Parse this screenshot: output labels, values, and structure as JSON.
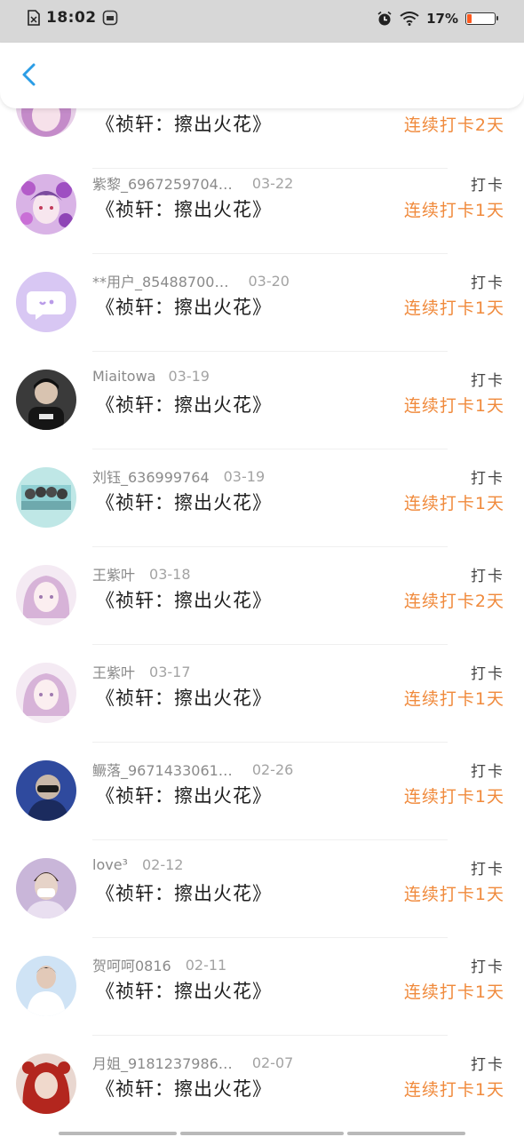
{
  "status_bar": {
    "time": "18:02",
    "battery_percent_text": "17%",
    "battery_level": 0.17,
    "left_icons": [
      "sim-off-icon",
      "app-notification-icon"
    ],
    "right_icons": [
      "alarm-icon",
      "wifi-icon",
      "battery-icon"
    ]
  },
  "app_bar": {
    "back_icon": "chevron-left-icon"
  },
  "colors": {
    "streak": "#f08a3c",
    "back_arrow": "#2b9de6",
    "username": "#8a8a8a"
  },
  "entries": [
    {
      "username": "",
      "date": "",
      "book": "《祯轩：擦出火花》",
      "tag": "",
      "streak": "连续打卡2天",
      "avatar": "anime-purple-hair"
    },
    {
      "username": "紫黎_6967259704…",
      "date": "03-22",
      "book": "《祯轩：擦出火花》",
      "tag": "打卡",
      "streak": "连续打卡1天",
      "avatar": "anime-purple-flowers"
    },
    {
      "username": "**用户_85488700…",
      "date": "03-20",
      "book": "《祯轩：擦出火花》",
      "tag": "打卡",
      "streak": "连续打卡1天",
      "avatar": "default-chat-bubble"
    },
    {
      "username": "Miaitowa",
      "date": "03-19",
      "book": "《祯轩：擦出火花》",
      "tag": "打卡",
      "streak": "连续打卡1天",
      "avatar": "dark-portrait"
    },
    {
      "username": "刘钰_636999764",
      "date": "03-19",
      "book": "《祯轩：擦出火花》",
      "tag": "打卡",
      "streak": "连续打卡1天",
      "avatar": "group-photo-teal"
    },
    {
      "username": "王紫叶",
      "date": "03-18",
      "book": "《祯轩：擦出火花》",
      "tag": "打卡",
      "streak": "连续打卡2天",
      "avatar": "anime-pink-hair"
    },
    {
      "username": "王紫叶",
      "date": "03-17",
      "book": "《祯轩：擦出火花》",
      "tag": "打卡",
      "streak": "连续打卡1天",
      "avatar": "anime-pink-hair"
    },
    {
      "username": "鳜落_9671433061…",
      "date": "02-26",
      "book": "《祯轩：擦出火花》",
      "tag": "打卡",
      "streak": "连续打卡1天",
      "avatar": "blue-portrait"
    },
    {
      "username": "love³",
      "date": "02-12",
      "book": "《祯轩：擦出火花》",
      "tag": "打卡",
      "streak": "连续打卡1天",
      "avatar": "masked-portrait"
    },
    {
      "username": "贺呵呵0816",
      "date": "02-11",
      "book": "《祯轩：擦出火花》",
      "tag": "打卡",
      "streak": "连续打卡1天",
      "avatar": "white-shirt-portrait"
    },
    {
      "username": "月姐_9181237986…",
      "date": "02-07",
      "book": "《祯轩：擦出火花》",
      "tag": "打卡",
      "streak": "连续打卡1天",
      "avatar": "red-hood-portrait"
    }
  ]
}
